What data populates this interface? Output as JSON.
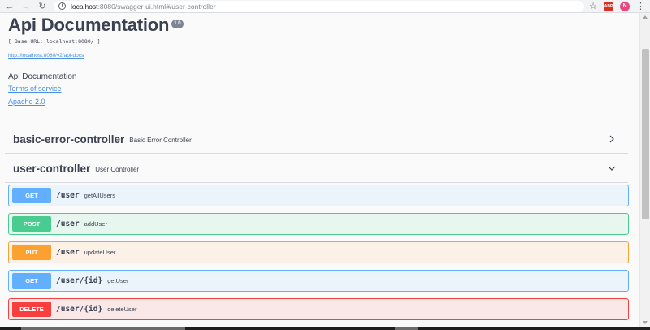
{
  "browser": {
    "url_host": "localhost",
    "url_rest": ":8080/swagger-ui.html#/user-controller",
    "avatar_letter": "N",
    "extension_label": "ABP"
  },
  "info": {
    "title": "Api Documentation",
    "version": "1.0",
    "base_url": "[ Base URL: localhost:8080/ ]",
    "docs_link": "http://localhost:8080/v2/api-docs",
    "description": "Api Documentation",
    "terms": "Terms of service",
    "license": "Apache 2.0"
  },
  "tags": [
    {
      "name": "basic-error-controller",
      "description": "Basic Error Controller",
      "expanded": false
    },
    {
      "name": "user-controller",
      "description": "User Controller",
      "expanded": true
    }
  ],
  "operations": [
    {
      "method": "GET",
      "path": "/user",
      "summary": "getAllUsers",
      "color": "#61affe"
    },
    {
      "method": "POST",
      "path": "/user",
      "summary": "addUser",
      "color": "#49cc90"
    },
    {
      "method": "PUT",
      "path": "/user",
      "summary": "updateUser",
      "color": "#fca130"
    },
    {
      "method": "GET",
      "path": "/user/{id}",
      "summary": "getUser",
      "color": "#61affe"
    },
    {
      "method": "DELETE",
      "path": "/user/{id}",
      "summary": "deleteUser",
      "color": "#f93e3e"
    }
  ]
}
